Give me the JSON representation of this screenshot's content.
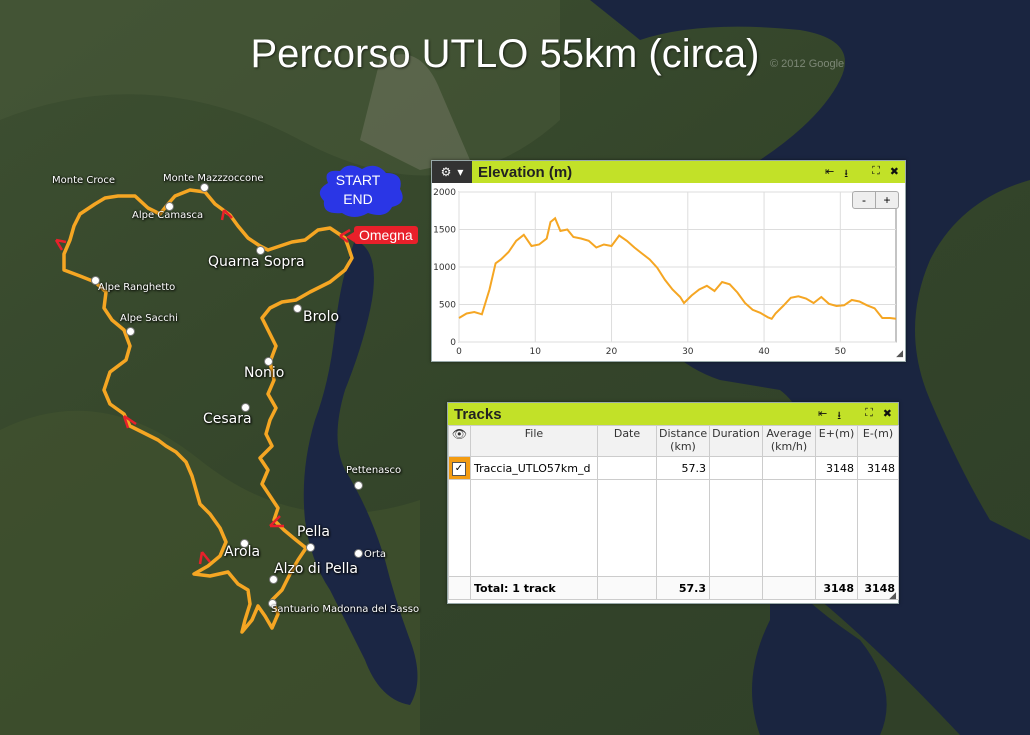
{
  "title": "Percorso UTLO 55km (circa)",
  "colors": {
    "route": "#f5a623",
    "panel_header": "#c2e128",
    "omegna": "#e8202a",
    "start_cloud": "#2a36e6"
  },
  "watermark": "© 2012 Google",
  "start_label": {
    "line1": "START",
    "line2": "END"
  },
  "omegna_label": "Omegna",
  "places": [
    {
      "name": "Monte Croce"
    },
    {
      "name": "Monte Mazzzoccone"
    },
    {
      "name": "Alpe Camasca"
    },
    {
      "name": "Quarna Sopra"
    },
    {
      "name": "Alpe Ranghetto"
    },
    {
      "name": "Alpe Sacchi"
    },
    {
      "name": "Brolo"
    },
    {
      "name": "Nonio"
    },
    {
      "name": "Cesara"
    },
    {
      "name": "Pettenasco"
    },
    {
      "name": "Pella"
    },
    {
      "name": "Orta"
    },
    {
      "name": "Arola"
    },
    {
      "name": "Alzo di Pella"
    },
    {
      "name": "Santuario Madonna del Sasso"
    }
  ],
  "elevation_panel": {
    "title": "Elevation (m)",
    "gear_icon": "gear-icon",
    "zoom_out": "-",
    "zoom_in": "+"
  },
  "chart_data": {
    "type": "line",
    "title": "Elevation (m)",
    "xlabel": "",
    "ylabel": "",
    "xlim": [
      0,
      57.3
    ],
    "ylim": [
      0,
      2000
    ],
    "xticks": [
      0,
      10,
      20,
      30,
      40,
      50
    ],
    "yticks": [
      0,
      500,
      1000,
      1500,
      2000
    ],
    "grid": true,
    "series": [
      {
        "x": [
          0,
          1,
          2,
          3,
          4,
          4.8,
          5.5,
          6.5,
          7.5,
          8.5,
          9.5,
          10.5,
          11.5,
          12,
          12.6,
          13.3,
          14.2,
          15,
          16,
          17,
          18,
          19,
          20,
          21,
          22,
          23,
          24,
          25,
          26,
          27,
          28,
          29,
          29.5,
          30.5,
          31.5,
          32.5,
          33.5,
          34.5,
          35.5,
          36.5,
          37.5,
          38.5,
          39.5,
          40.5,
          41,
          41.5,
          42.5,
          43.5,
          44.5,
          45.5,
          46.5,
          47.5,
          48.5,
          49.5,
          50.5,
          51.5,
          52.5,
          53.5,
          54.5,
          55.5,
          56.5,
          57.3
        ],
        "y": [
          320,
          380,
          400,
          370,
          700,
          1050,
          1100,
          1200,
          1350,
          1430,
          1280,
          1300,
          1380,
          1600,
          1650,
          1480,
          1500,
          1400,
          1380,
          1350,
          1260,
          1300,
          1280,
          1420,
          1350,
          1260,
          1180,
          1100,
          990,
          830,
          700,
          600,
          520,
          620,
          700,
          750,
          680,
          800,
          770,
          660,
          520,
          430,
          390,
          330,
          310,
          380,
          480,
          590,
          610,
          580,
          520,
          600,
          510,
          480,
          490,
          560,
          540,
          490,
          450,
          320,
          320,
          310
        ]
      }
    ]
  },
  "tracks_panel": {
    "title": "Tracks",
    "headers": [
      "File",
      "Date",
      "Distance (km)",
      "Duration",
      "Average (km/h)",
      "E+(m)",
      "E-(m)"
    ],
    "rows": [
      {
        "checked": true,
        "file": "Traccia_UTLO57km_d",
        "date": "",
        "distance": "57.3",
        "duration": "",
        "average": "",
        "eplus": "3148",
        "eminus": "3148"
      }
    ],
    "total": {
      "label": "Total: 1 track",
      "distance": "57.3",
      "duration": "",
      "average": "",
      "eplus": "3148",
      "eminus": "3148"
    }
  }
}
